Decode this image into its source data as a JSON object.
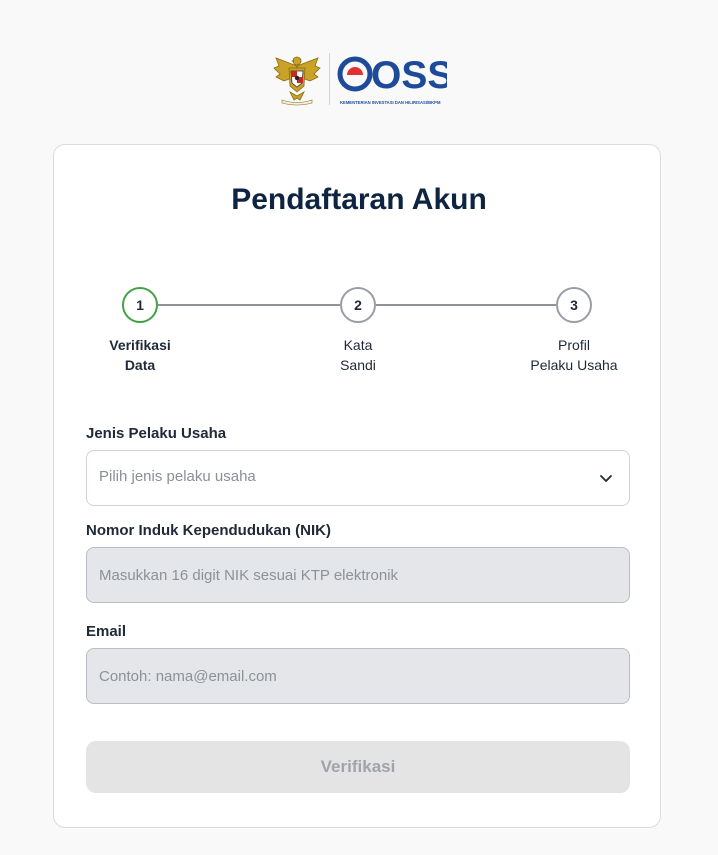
{
  "header": {
    "emblem_icon": "garuda-pancasila-emblem",
    "logo_text": "OSS",
    "logo_subtitle": "KEMENTERIAN INVESTASI DAN HILIRISASI/BKPM",
    "colors": {
      "brand_blue": "#1e4a9a",
      "brand_red": "#e03030",
      "brand_green": "#3fa34d"
    }
  },
  "page": {
    "title": "Pendaftaran Akun"
  },
  "stepper": {
    "steps": [
      {
        "number": "1",
        "line1": "Verifikasi",
        "line2": "Data",
        "state": "active"
      },
      {
        "number": "2",
        "line1": "Kata",
        "line2": "Sandi",
        "state": "inactive"
      },
      {
        "number": "3",
        "line1": "Profil",
        "line2": "Pelaku Usaha",
        "state": "inactive"
      }
    ],
    "active_color": "#43a047"
  },
  "form": {
    "business_type": {
      "label": "Jenis Pelaku Usaha",
      "placeholder": "Pilih jenis pelaku usaha",
      "value": ""
    },
    "nik": {
      "label": "Nomor Induk Kependudukan (NIK)",
      "placeholder": "Masukkan 16 digit NIK sesuai KTP elektronik",
      "value": ""
    },
    "email": {
      "label": "Email",
      "placeholder": "Contoh: nama@email.com",
      "value": ""
    },
    "submit_label": "Verifikasi"
  }
}
